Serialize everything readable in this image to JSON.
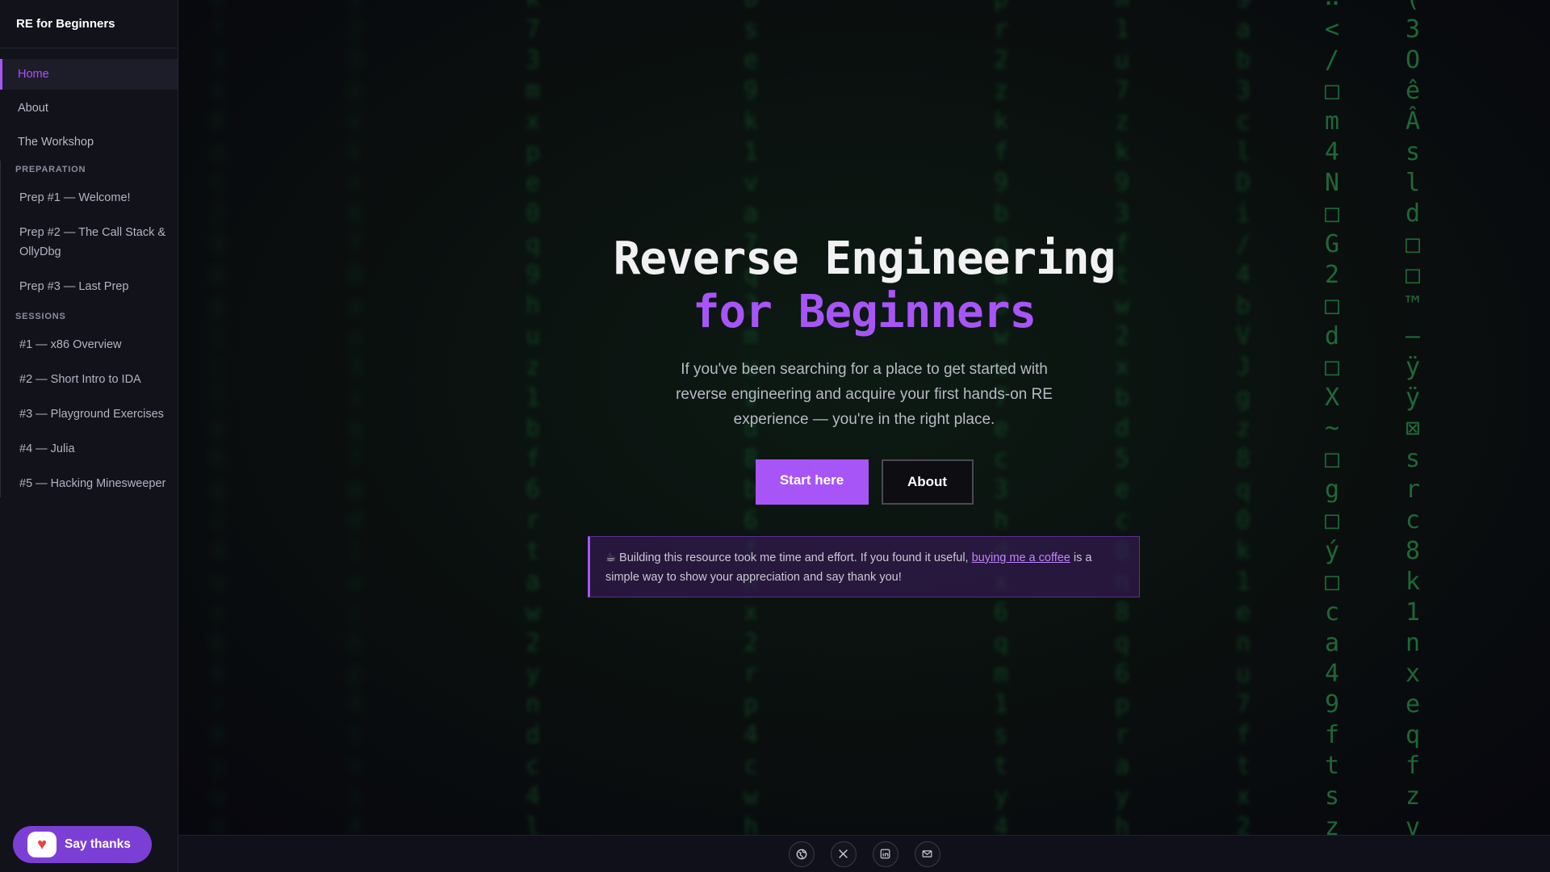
{
  "app": {
    "brand": "RE for Beginners"
  },
  "sidebar": {
    "items": [
      {
        "label": "Home",
        "active": true
      },
      {
        "label": "About"
      },
      {
        "label": "The Workshop"
      }
    ],
    "sections": [
      {
        "title": "PREPARATION",
        "items": [
          "Prep #1 — Welcome!",
          "Prep #2 — The Call Stack & OllyDbg",
          "Prep #3 — Last Prep"
        ]
      },
      {
        "title": "SESSIONS",
        "items": [
          "#1 — x86 Overview",
          "#2 — Short Intro to IDA",
          "#3 — Playground Exercises",
          "#4 — Julia",
          "#5 — Hacking Minesweeper"
        ]
      }
    ],
    "say_thanks": {
      "label": "Say thanks",
      "icon": "heart-mug-icon"
    }
  },
  "hero": {
    "title_line1": "Reverse Engineering",
    "title_line2": "for Beginners",
    "subtitle": "If you've been searching for a place to get started with reverse engineering and acquire your first hands-on RE experience — you're in the right place.",
    "primary_button": "Start here",
    "secondary_button": "About"
  },
  "notice": {
    "icon": "☕",
    "text_before": " Building this resource took me time and effort. If you found it useful, ",
    "link": "buying me a coffee",
    "text_after": " is a simple way to show your appreciation and say thank you!"
  },
  "footer": {
    "icons": [
      "globe-icon",
      "x-icon",
      "linkedin-icon",
      "email-icon"
    ]
  },
  "colors": {
    "accent": "#a855f7",
    "background": "#0c0c14",
    "sidebar": "#12121b",
    "matrix_green": "#1e8f44"
  }
}
